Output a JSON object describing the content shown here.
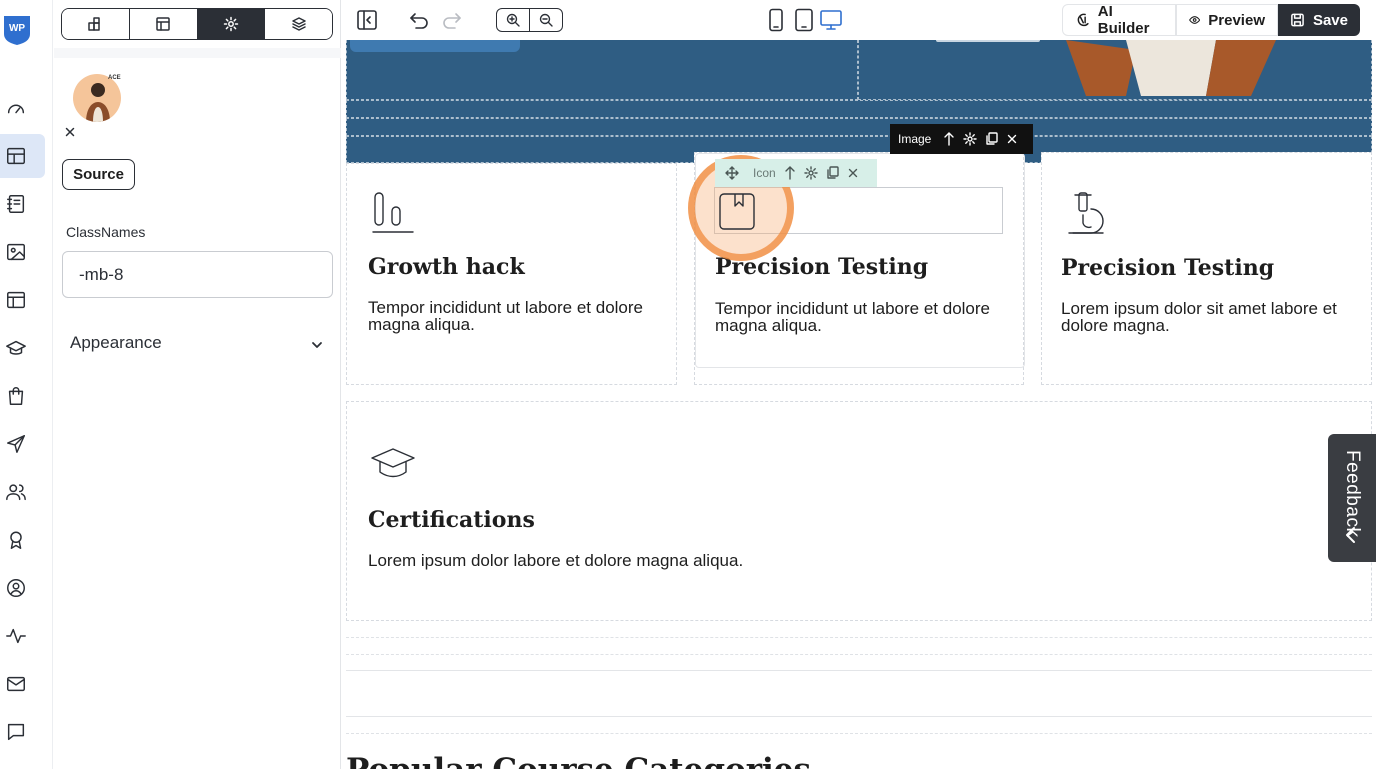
{
  "app": {
    "logo_text": "WP"
  },
  "rail": {
    "items": [
      {
        "icon": "gauge-icon",
        "active": false
      },
      {
        "icon": "layout-icon",
        "active": true
      },
      {
        "icon": "notebook-icon",
        "active": false
      },
      {
        "icon": "image-icon",
        "active": false
      },
      {
        "icon": "table-layout-icon",
        "active": false
      },
      {
        "icon": "graduation-cap-icon",
        "active": false
      },
      {
        "icon": "shopping-bag-icon",
        "active": false
      },
      {
        "icon": "send-icon",
        "active": false
      },
      {
        "icon": "users-icon",
        "active": false
      },
      {
        "icon": "award-icon",
        "active": false
      },
      {
        "icon": "user-circle-icon",
        "active": false
      },
      {
        "icon": "activity-icon",
        "active": false
      },
      {
        "icon": "mail-icon",
        "active": false
      },
      {
        "icon": "message-icon",
        "active": false
      }
    ]
  },
  "panel": {
    "tabs": [
      {
        "icon": "blocks-icon",
        "active": false
      },
      {
        "icon": "layout-panel-icon",
        "active": false
      },
      {
        "icon": "gear-icon",
        "active": true
      },
      {
        "icon": "layers-icon",
        "active": false
      }
    ],
    "avatar_badge": "ACE",
    "source_label": "Source",
    "classnames_label": "ClassNames",
    "classnames_value": "-mb-8",
    "appearance_label": "Appearance"
  },
  "toolbar": {
    "ai_label": "AI Builder",
    "preview_label": "Preview",
    "save_label": "Save"
  },
  "canvas": {
    "cards": [
      {
        "title": "Growth hack",
        "text": "Tempor incididunt ut labore et dolore magna aliqua."
      },
      {
        "title": "Precision Testing",
        "text": "Tempor incididunt ut labore et dolore magna aliqua."
      },
      {
        "title": "Precision Testing",
        "text": "Lorem ipsum dolor sit amet  labore et dolore magna."
      },
      {
        "title": "Certifications",
        "text": "Lorem ipsum dolor  labore et dolore magna aliqua."
      }
    ],
    "image_toolbar_label": "Image",
    "icon_toolbar_label": "Icon",
    "section_heading": "Popular Course Categories"
  },
  "feedback": {
    "label": "Feedback"
  },
  "colors": {
    "accent": "#2b2f36",
    "hero": "#2f5d83",
    "highlight": "#f08b3c",
    "active_rail": "#dde7f7"
  }
}
